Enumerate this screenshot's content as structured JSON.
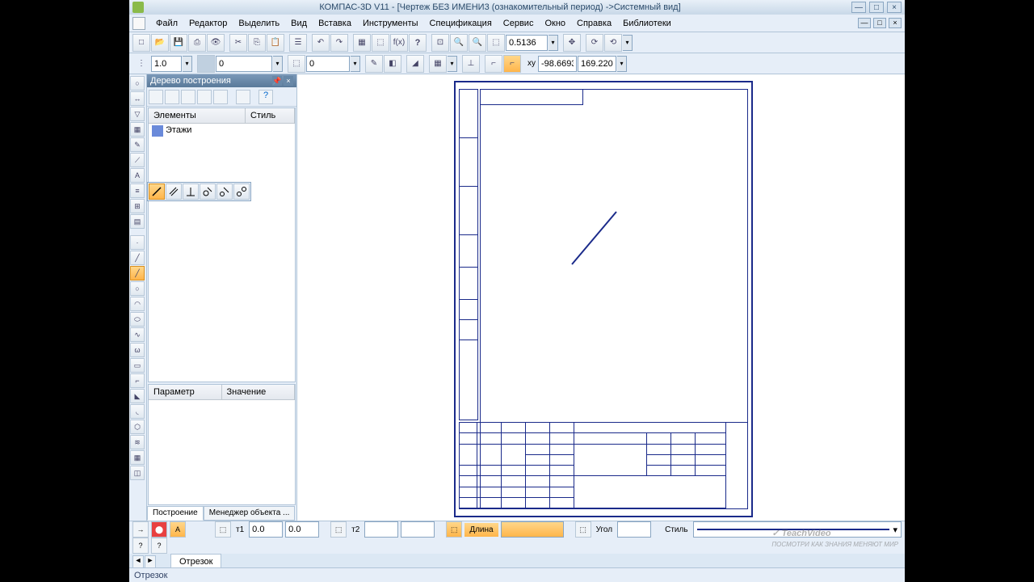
{
  "title": "КОМПАС-3D V11 - [Чертеж БЕЗ ИМЕНИ3 (ознакомительный период) ->Системный вид]",
  "menu": [
    "Файл",
    "Редактор",
    "Выделить",
    "Вид",
    "Вставка",
    "Инструменты",
    "Спецификация",
    "Сервис",
    "Окно",
    "Справка",
    "Библиотеки"
  ],
  "toolbar1": {
    "zoom_value": "0.5136",
    "coord_x": "-98.6693",
    "coord_y": "169.220"
  },
  "toolbar2": {
    "scale": "1.0",
    "layer": "0",
    "view": "0"
  },
  "panel": {
    "title": "Дерево построения",
    "cols": {
      "elements": "Элементы",
      "style": "Стиль"
    },
    "item": "Этажи",
    "params_cols": {
      "param": "Параметр",
      "value": "Значение"
    },
    "tabs": {
      "build": "Построение",
      "manager": "Менеджер объекта ..."
    }
  },
  "prop": {
    "t1_label": "т1",
    "t1_x": "0.0",
    "t1_y": "0.0",
    "t2_label": "т2",
    "length_label": "Длина",
    "angle_label": "Угол",
    "style_label": "Стиль",
    "tab": "Отрезок"
  },
  "status": "Отрезок",
  "watermark": {
    "brand": "TeachVideo",
    "sub": "ПОСМОТРИ КАК ЗНАНИЯ МЕНЯЮТ МИР"
  }
}
